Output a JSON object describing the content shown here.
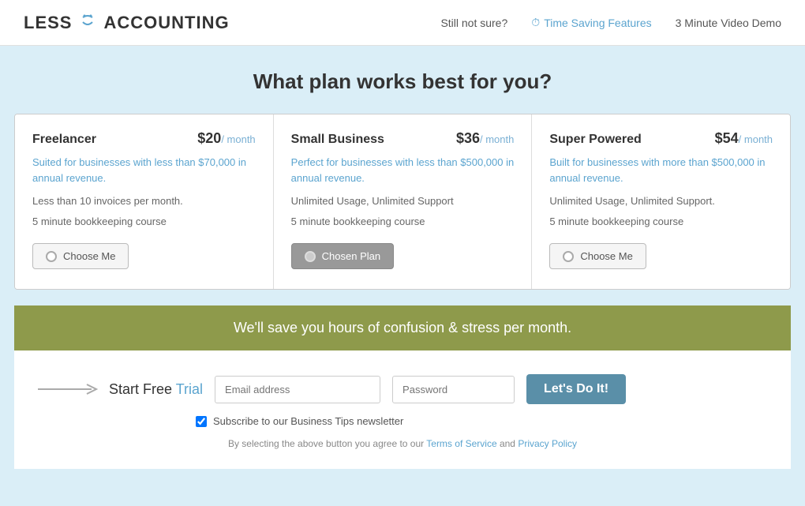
{
  "header": {
    "logo_less": "LESS",
    "logo_accounting": "ACCOUNTING",
    "nav_still": "Still not sure?",
    "nav_time": "Time Saving Features",
    "nav_video": "3 Minute Video Demo"
  },
  "main_heading": "What plan works best for you?",
  "plans": [
    {
      "id": "freelancer",
      "name": "Freelancer",
      "amount": "$20",
      "period": "/ month",
      "desc": "Suited for businesses with less than $70,000 in annual revenue.",
      "feature1": "Less than 10 invoices per month.",
      "feature2": "5 minute bookkeeping course",
      "btn_label": "Choose Me",
      "chosen": false
    },
    {
      "id": "small-business",
      "name": "Small Business",
      "amount": "$36",
      "period": "/ month",
      "desc": "Perfect for businesses with less than $500,000 in annual revenue.",
      "feature1": "Unlimited Usage, Unlimited Support",
      "feature2": "5 minute bookkeeping course",
      "btn_label": "Chosen Plan",
      "chosen": true
    },
    {
      "id": "super-powered",
      "name": "Super Powered",
      "amount": "$54",
      "period": "/ month",
      "desc": "Built for businesses with more than $500,000 in annual revenue.",
      "feature1": "Unlimited Usage, Unlimited Support.",
      "feature2": "5 minute bookkeeping course",
      "btn_label": "Choose Me",
      "chosen": false
    }
  ],
  "banner": {
    "text": "We'll save you hours of confusion & stress per month."
  },
  "signup": {
    "start_text": "Start Free ",
    "trial_text": "Trial",
    "email_placeholder": "Email address",
    "password_placeholder": "Password",
    "btn_label": "Let's Do It!",
    "newsletter_label": "Subscribe to our Business Tips newsletter",
    "terms_text": "By selecting the above button you agree to our ",
    "terms_link": "Terms of Service",
    "and_text": " and ",
    "privacy_link": "Privacy Policy"
  }
}
